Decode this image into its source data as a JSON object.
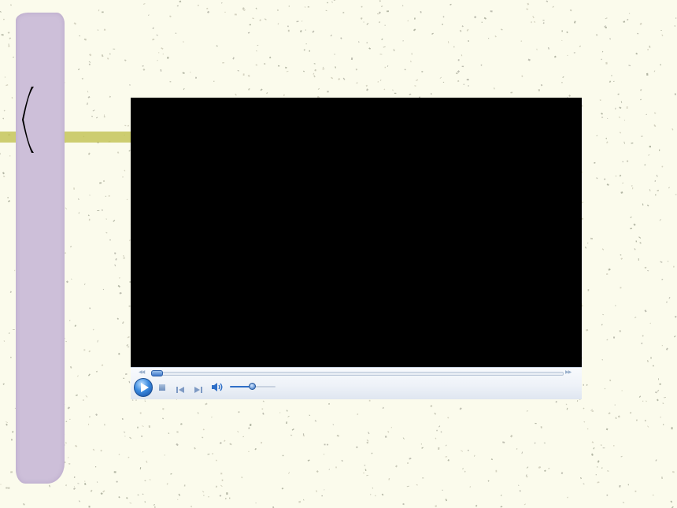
{
  "slide": {
    "background_color": "#fbfbec",
    "speckle_colors": [
      "#c9c9b8",
      "#bdbdb0",
      "#d4d2c0",
      "#b3b6a4"
    ],
    "left_strip_color": "#cdbfd9",
    "accent_bar_color": "#c2c254",
    "bracket_icon": "left-bracket-icon"
  },
  "player": {
    "video_background": "#000000",
    "controls": {
      "play_icon": "play-icon",
      "stop_icon": "stop-icon",
      "previous_icon": "previous-track-icon",
      "next_icon": "next-track-icon",
      "volume_icon": "speaker-icon",
      "seek_back_icon": "rewind-icon",
      "seek_forward_icon": "fast-forward-icon",
      "seek_progress": 0.0,
      "volume_level": 0.5,
      "accent_color": "#2f6fc7"
    }
  }
}
